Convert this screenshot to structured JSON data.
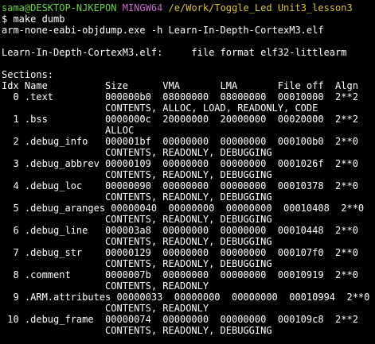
{
  "prompt": {
    "user_host": "sama@DESKTOP-NJKEPON",
    "shell": "MINGW64",
    "path": "/e/Work/Toggle_Led Unit3_lesson3"
  },
  "command": "$ make dumb",
  "echo_command": "arm-none-eabi-objdump.exe -h Learn-In-Depth-CortexM3.elf",
  "file_line": "Learn-In-Depth-CortexM3.elf:     file format elf32-littlearm",
  "sections_title": "Sections:",
  "header_line": "Idx Name          Size      VMA       LMA       File off  Algn",
  "rows": [
    {
      "main": "  0 .text         000000b0  08000000  08000000  00010000  2**2",
      "flags": "                  CONTENTS, ALLOC, LOAD, READONLY, CODE"
    },
    {
      "main": "  1 .bss          0000000c  20000000  20000000  00020000  2**2",
      "flags": "                  ALLOC"
    },
    {
      "main": "  2 .debug_info   000001bf  00000000  00000000  000100b0  2**0",
      "flags": "                  CONTENTS, READONLY, DEBUGGING"
    },
    {
      "main": "  3 .debug_abbrev 00000109  00000000  00000000  0001026f  2**0",
      "flags": "                  CONTENTS, READONLY, DEBUGGING"
    },
    {
      "main": "  4 .debug_loc    00000090  00000000  00000000  00010378  2**0",
      "flags": "                  CONTENTS, READONLY, DEBUGGING"
    },
    {
      "main": "  5 .debug_aranges 00000040  00000000  00000000  00010408  2**0",
      "flags": "                  CONTENTS, READONLY, DEBUGGING"
    },
    {
      "main": "  6 .debug_line   000003a8  00000000  00000000  00010448  2**0",
      "flags": "                  CONTENTS, READONLY, DEBUGGING"
    },
    {
      "main": "  7 .debug_str    00000129  00000000  00000000  000107f0  2**0",
      "flags": "                  CONTENTS, READONLY, DEBUGGING"
    },
    {
      "main": "  8 .comment      0000007b  00000000  00000000  00010919  2**0",
      "flags": "                  CONTENTS, READONLY"
    },
    {
      "main": "  9 .ARM.attributes 00000033  00000000  00000000  00010994  2**0",
      "flags": "                  CONTENTS, READONLY"
    },
    {
      "main": " 10 .debug_frame  00000074  00000000  00000000  000109c8  2**2",
      "flags": "                  CONTENTS, READONLY, DEBUGGING"
    }
  ],
  "colors": {
    "background": "#000000",
    "text": "#ffffff",
    "user_host": "#6bd04b",
    "shell": "#c46ec9",
    "path": "#d7c23c"
  }
}
